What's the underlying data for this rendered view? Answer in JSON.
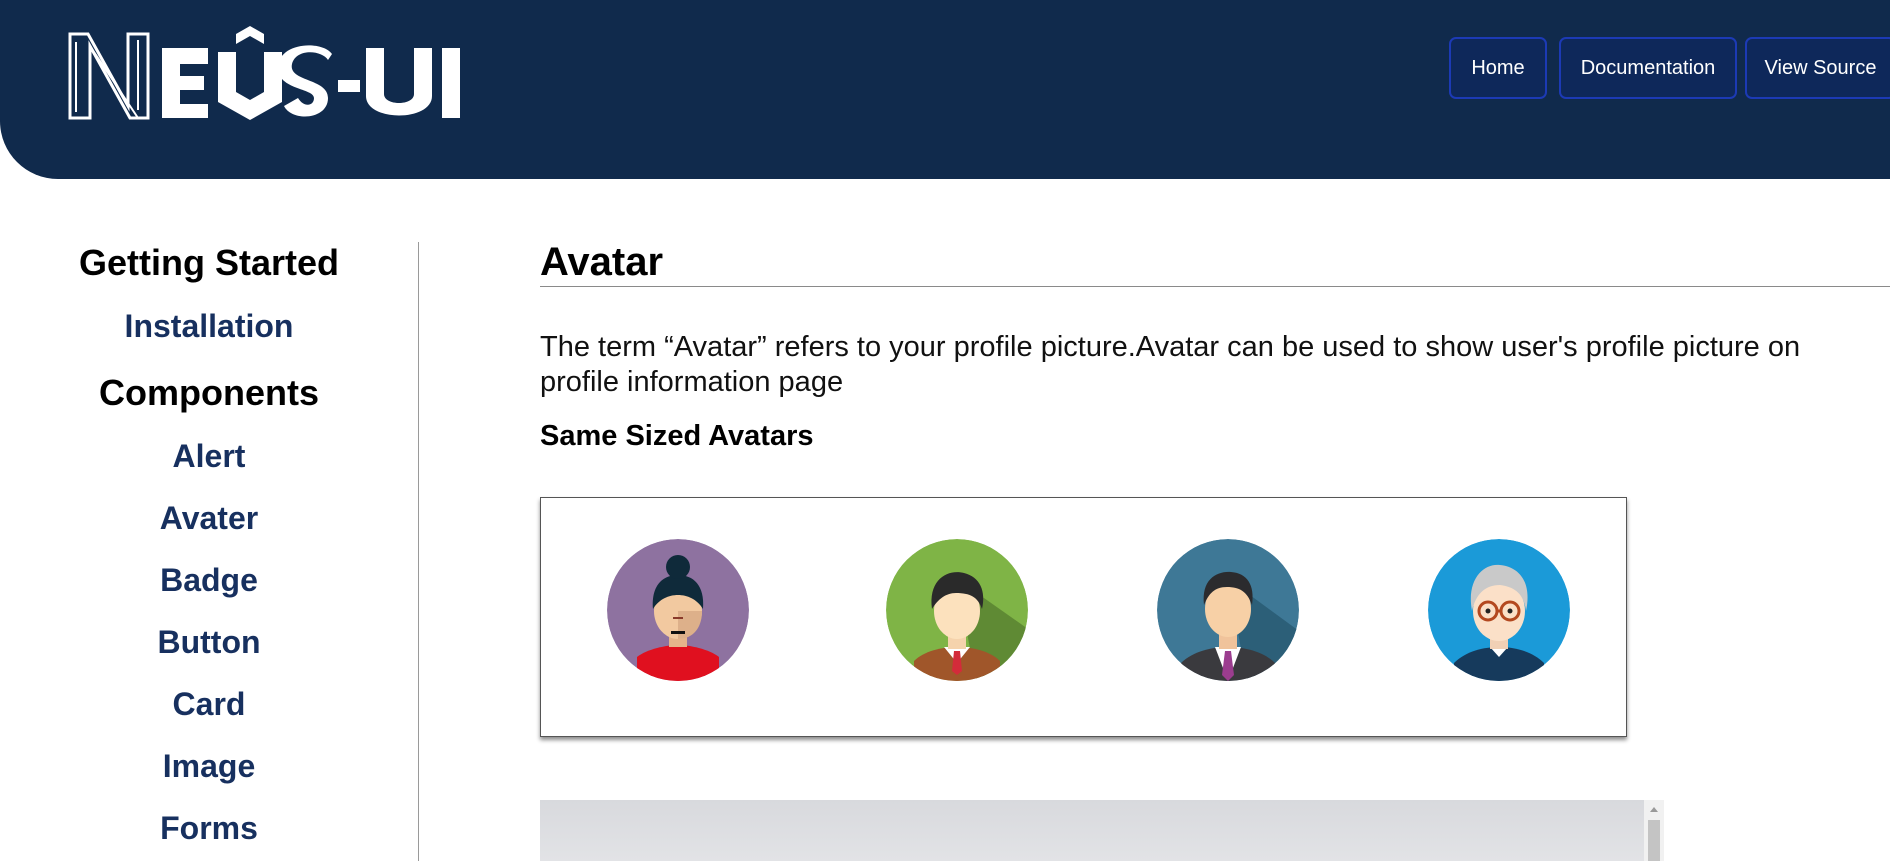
{
  "header": {
    "logo_text": "NEUS-UI",
    "background": "#102a4c",
    "nav": [
      {
        "label": "Home"
      },
      {
        "label": "Documentation"
      },
      {
        "label": "View Source"
      }
    ]
  },
  "sidebar": {
    "heading_started": "Getting Started",
    "installation": "Installation",
    "heading_components": "Components",
    "items": [
      {
        "label": "Alert"
      },
      {
        "label": "Avater"
      },
      {
        "label": "Badge"
      },
      {
        "label": "Button"
      },
      {
        "label": "Card"
      },
      {
        "label": "Image"
      },
      {
        "label": "Forms"
      }
    ]
  },
  "main": {
    "title": "Avatar",
    "intro": "The term “Avatar” refers to your profile picture.Avatar can be used to show user's profile picture on profile information page",
    "subheading": "Same Sized Avatars",
    "avatars": [
      {
        "icon": "woman-avatar-icon",
        "bg": "#8e72a0"
      },
      {
        "icon": "young-man-avatar-icon",
        "bg": "#7fb446"
      },
      {
        "icon": "businessman-avatar-icon",
        "bg": "#3e7896"
      },
      {
        "icon": "old-man-avatar-icon",
        "bg": "#1b9ad8"
      }
    ]
  }
}
